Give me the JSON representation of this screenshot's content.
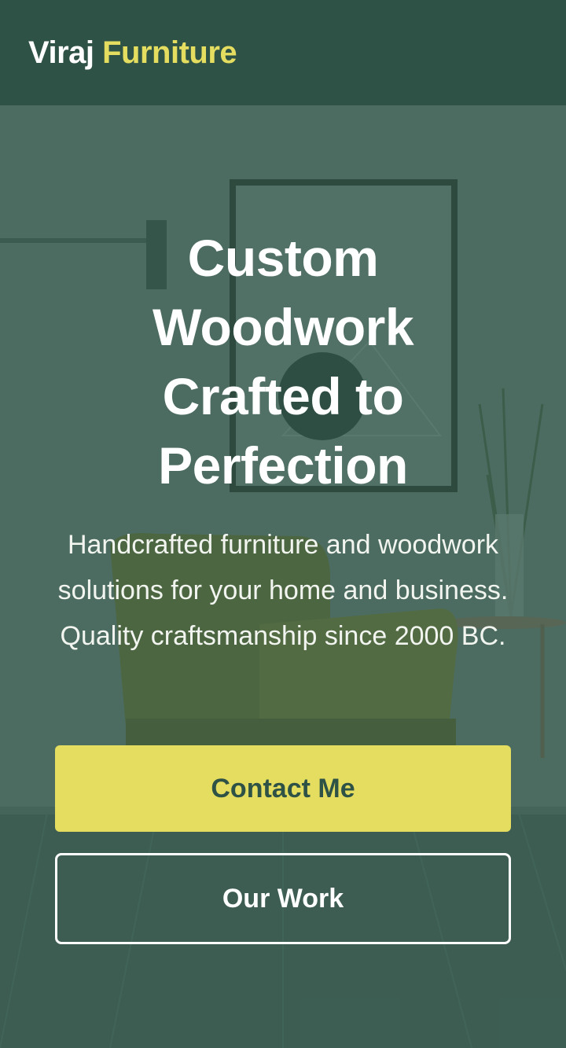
{
  "header": {
    "brand_main": "Viraj",
    "brand_accent": "Furniture"
  },
  "hero": {
    "title": "Custom Woodwork Crafted to Perfection",
    "subtitle": "Handcrafted furniture and woodwork solutions for your home and business. Quality craftsmanship since 2000 BC.",
    "primary_button": "Contact Me",
    "secondary_button": "Our Work"
  },
  "colors": {
    "header_bg": "#2f5246",
    "accent": "#e5dd5f",
    "overlay": "#2f5246",
    "text_light": "#ffffff"
  }
}
